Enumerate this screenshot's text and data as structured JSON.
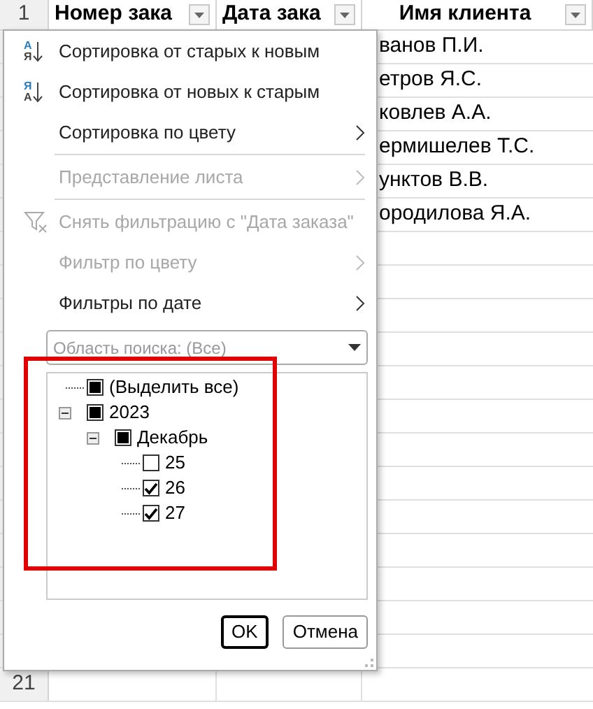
{
  "sheet": {
    "header_row": {
      "number": "1",
      "columns": [
        {
          "label": "Номер зака"
        },
        {
          "label": "Дата зака"
        },
        {
          "label": "Имя клиента"
        }
      ]
    },
    "client_names": [
      "ванов П.И.",
      "етров Я.С.",
      "ковлев А.А.",
      "ермишелев Т.С.",
      "унктов В.В.",
      "ородилова Я.А."
    ],
    "last_row_number": "21"
  },
  "filter_menu": {
    "items": [
      {
        "kind": "item",
        "label": "Сортировка от старых к новым",
        "disabled": false,
        "submenu": false,
        "icon": {
          "kind": "sort",
          "top": "А",
          "bottom": "Я"
        }
      },
      {
        "kind": "item",
        "label": "Сортировка от новых к старым",
        "disabled": false,
        "submenu": false,
        "icon": {
          "kind": "sort",
          "top": "Я",
          "bottom": "А"
        }
      },
      {
        "kind": "item",
        "label": "Сортировка по цвету",
        "disabled": false,
        "submenu": true
      },
      {
        "kind": "separator"
      },
      {
        "kind": "item",
        "label": "Представление листа",
        "disabled": true,
        "submenu": true
      },
      {
        "kind": "separator"
      },
      {
        "kind": "item",
        "label": "Снять фильтрацию с \"Дата заказа\"",
        "disabled": true,
        "submenu": false,
        "icon": {
          "kind": "clear-filter"
        }
      },
      {
        "kind": "item",
        "label": "Фильтр по цвету",
        "disabled": true,
        "submenu": true
      },
      {
        "kind": "item",
        "label": "Фильтры по дате",
        "disabled": false,
        "submenu": true
      }
    ],
    "search": {
      "placeholder": "Область поиска: (Все)"
    },
    "tree": [
      {
        "label": "(Выделить все)",
        "partial": true
      },
      {
        "label": "2023",
        "partial": true,
        "expanded": true,
        "children": [
          {
            "label": "Декабрь",
            "partial": true,
            "expanded": true,
            "children": [
              {
                "label": "25",
                "checked": false
              },
              {
                "label": "26",
                "checked": true
              },
              {
                "label": "27",
                "checked": true
              }
            ]
          }
        ]
      }
    ],
    "buttons": [
      {
        "label": "OK",
        "default": true
      },
      {
        "label": "Отмена",
        "default": false
      }
    ]
  }
}
